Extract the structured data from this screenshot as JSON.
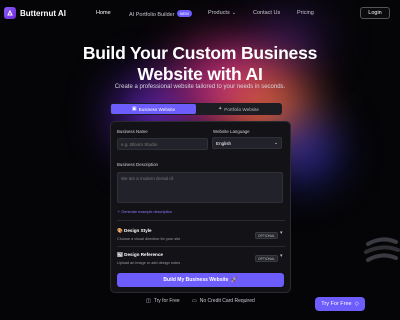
{
  "nav": {
    "brand": "Butternut AI",
    "links": [
      {
        "label": "Home"
      },
      {
        "label": "AI Portfolio Builder",
        "badge": "NEW"
      },
      {
        "label": "Products"
      },
      {
        "label": "Contact Us"
      },
      {
        "label": "Pricing"
      }
    ],
    "login": "Login"
  },
  "hero": {
    "title_line1": "Build Your Custom Business",
    "title_line2": "Website with AI",
    "subtitle": "Create a professional website tailored to your needs in seconds."
  },
  "tabs": [
    {
      "label": "Business Website",
      "active": true
    },
    {
      "label": "Portfolio Website",
      "active": false
    }
  ],
  "form": {
    "business_name_label": "Business Name",
    "business_name_placeholder": "e.g. Bloom Studio",
    "language_label": "Website Language",
    "language_value": "English",
    "description_label": "Business Description",
    "description_placeholder": "We are a modern dental cli",
    "generate_link": "Generate example description",
    "sections": [
      {
        "title": "Design Style",
        "description": "Choose a visual direction for your site",
        "badge": "OPTIONAL"
      },
      {
        "title": "Design Reference",
        "description": "Upload an image or add design notes",
        "badge": "OPTIONAL"
      }
    ],
    "build_button": "Build My Business Website"
  },
  "footer": {
    "try_free": "Try for Free",
    "no_card": "No Credit Card Required",
    "try_button": "Try For Free"
  },
  "colors": {
    "accent": "#6d5dfc",
    "background": "#050507",
    "card": "#131317"
  }
}
